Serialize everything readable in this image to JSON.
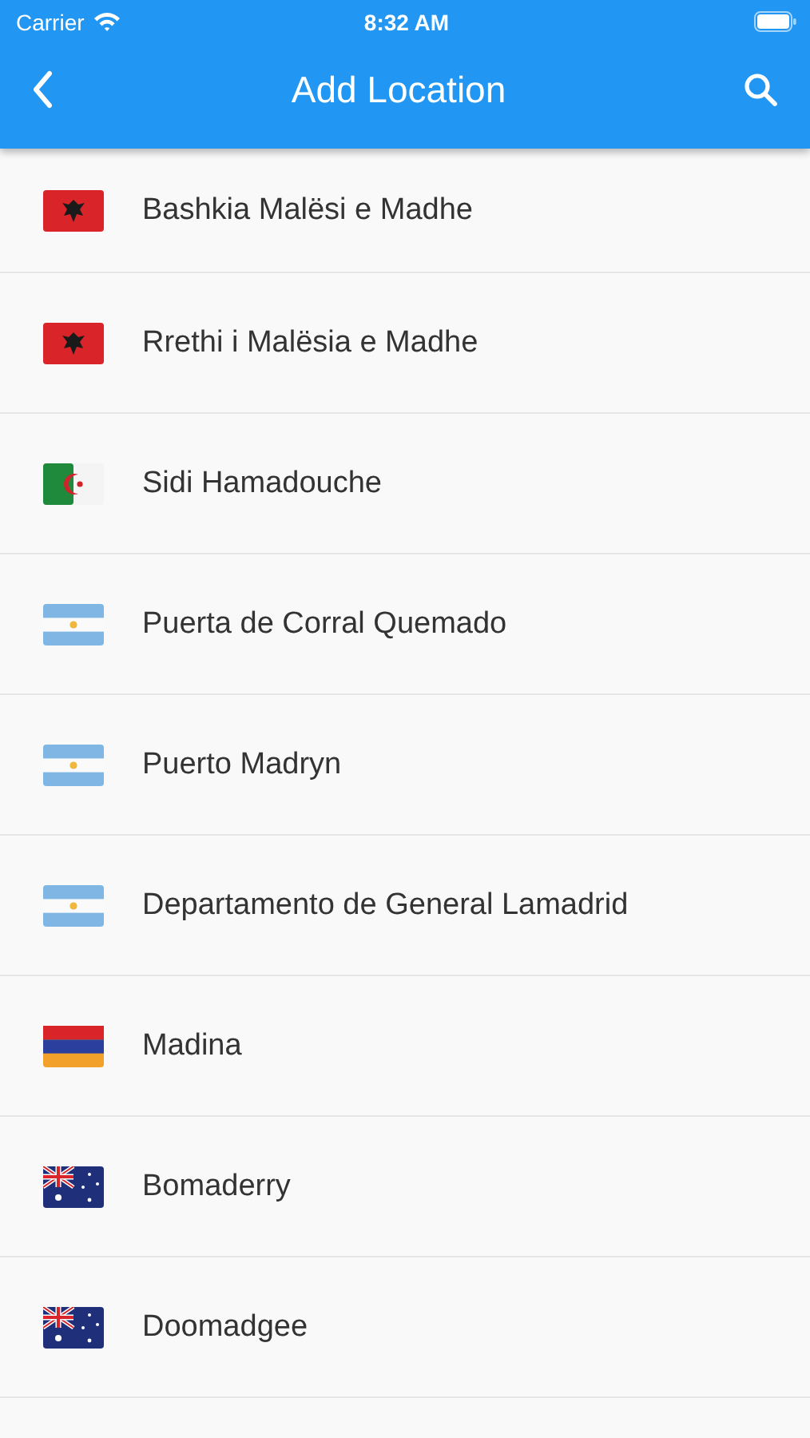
{
  "status_bar": {
    "carrier": "Carrier",
    "time": "8:32 AM"
  },
  "app_bar": {
    "title": "Add Location"
  },
  "locations": [
    {
      "name": "Bashkia Malësi e Madhe",
      "kind": "albania"
    },
    {
      "name": "Rrethi i Malësia e Madhe",
      "kind": "albania"
    },
    {
      "name": "Sidi Hamadouche",
      "kind": "algeria"
    },
    {
      "name": "Puerta de Corral Quemado",
      "kind": "argentina"
    },
    {
      "name": "Puerto Madryn",
      "kind": "argentina"
    },
    {
      "name": "Departamento de General Lamadrid",
      "kind": "argentina"
    },
    {
      "name": "Madina",
      "kind": "armenia"
    },
    {
      "name": "Bomaderry",
      "kind": "australia"
    },
    {
      "name": "Doomadgee",
      "kind": "australia"
    }
  ]
}
